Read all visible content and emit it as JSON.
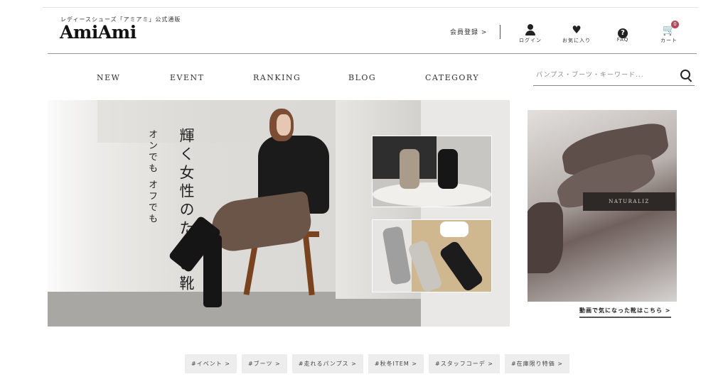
{
  "header": {
    "tagline": "レディースシューズ「アミアミ」公式通販",
    "logo": "AmiAmi",
    "register": "会員登録 >",
    "icons": [
      {
        "name": "person-icon",
        "label": "ログイン"
      },
      {
        "name": "heart-icon",
        "label": "お気に入り"
      },
      {
        "name": "faq-icon",
        "label": "FAQ"
      },
      {
        "name": "cart-icon",
        "label": "カート",
        "badge": "0"
      }
    ]
  },
  "nav": {
    "items": [
      "NEW",
      "EVENT",
      "RANKING",
      "BLOG",
      "CATEGORY"
    ]
  },
  "search": {
    "placeholder": "パンプス・ブーツ・キーワード..."
  },
  "hero": {
    "headline": "輝く女性のための靴",
    "subline": "オンでも オフでも"
  },
  "side": {
    "box_text": "NATURALIZ",
    "caption": "動画で気になった靴はこちら >"
  },
  "tags": [
    "#イベント >",
    "#ブーツ >",
    "#走れるパンプス >",
    "#秋冬ITEM >",
    "#スタッフコーデ >",
    "#在庫限り特価 >"
  ],
  "colors": {
    "badge": "#b3475b",
    "text": "#222222"
  }
}
